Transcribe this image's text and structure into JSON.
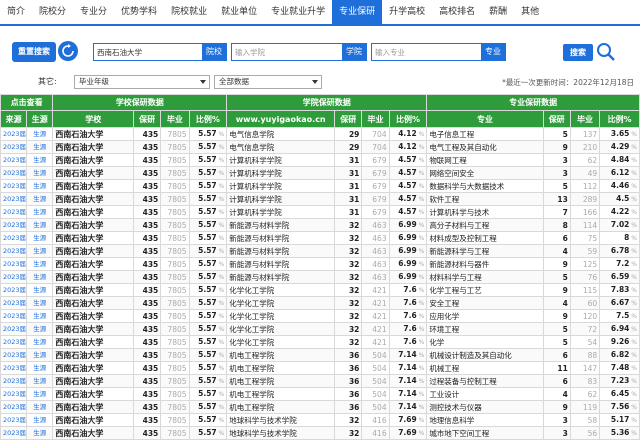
{
  "nav": [
    "简介",
    "院校分",
    "专业分",
    "优势学科",
    "院校就业",
    "就业单位",
    "专业就业升学",
    "专业保研",
    "升学高校",
    "高校排名",
    "薪酬",
    "其他"
  ],
  "nav_active": 7,
  "search": {
    "reset_label": "重置搜索",
    "school_value": "西南石油大学",
    "school_label": "院校",
    "college_placeholder": "输入学院",
    "college_label": "学院",
    "major_placeholder": "输入专业",
    "major_label": "专业",
    "search_label": "搜索"
  },
  "filters": {
    "other_label": "其它:",
    "select1": "毕业年级",
    "select2": "全部数据",
    "note": "*最近一次更新时间：2022年12月18日"
  },
  "table": {
    "group_headers": [
      "点击查看",
      "学校保研数据",
      "学院保研数据",
      "专业保研数据"
    ],
    "watermark": "www.yuyigaokao.cn",
    "columns": [
      "来源",
      "生源",
      "学校",
      "保研",
      "毕业",
      "比例%",
      "学院",
      "保研",
      "毕业",
      "比例%",
      "专业",
      "保研",
      "毕业",
      "比例%"
    ],
    "rows": [
      [
        "2023届",
        "生源",
        "西南石油大学",
        "435",
        "7805",
        "5.57",
        "电气信息学院",
        "29",
        "704",
        "4.12",
        "电子信息工程",
        "5",
        "137",
        "3.65"
      ],
      [
        "2023届",
        "生源",
        "西南石油大学",
        "435",
        "7805",
        "5.57",
        "电气信息学院",
        "29",
        "704",
        "4.12",
        "电气工程及其自动化",
        "9",
        "210",
        "4.29"
      ],
      [
        "2023届",
        "生源",
        "西南石油大学",
        "435",
        "7805",
        "5.57",
        "计算机科学学院",
        "31",
        "679",
        "4.57",
        "物联网工程",
        "3",
        "62",
        "4.84"
      ],
      [
        "2023届",
        "生源",
        "西南石油大学",
        "435",
        "7805",
        "5.57",
        "计算机科学学院",
        "31",
        "679",
        "4.57",
        "网络空间安全",
        "3",
        "49",
        "6.12"
      ],
      [
        "2023届",
        "生源",
        "西南石油大学",
        "435",
        "7805",
        "5.57",
        "计算机科学学院",
        "31",
        "679",
        "4.57",
        "数据科学与大数据技术",
        "5",
        "112",
        "4.46"
      ],
      [
        "2023届",
        "生源",
        "西南石油大学",
        "435",
        "7805",
        "5.57",
        "计算机科学学院",
        "31",
        "679",
        "4.57",
        "软件工程",
        "13",
        "289",
        "4.5"
      ],
      [
        "2023届",
        "生源",
        "西南石油大学",
        "435",
        "7805",
        "5.57",
        "计算机科学学院",
        "31",
        "679",
        "4.57",
        "计算机科学与技术",
        "7",
        "166",
        "4.22"
      ],
      [
        "2023届",
        "生源",
        "西南石油大学",
        "435",
        "7805",
        "5.57",
        "新能源与材料学院",
        "32",
        "463",
        "6.99",
        "高分子材料与工程",
        "8",
        "114",
        "7.02"
      ],
      [
        "2023届",
        "生源",
        "西南石油大学",
        "435",
        "7805",
        "5.57",
        "新能源与材料学院",
        "32",
        "463",
        "6.99",
        "材料成型及控制工程",
        "6",
        "75",
        "8"
      ],
      [
        "2023届",
        "生源",
        "西南石油大学",
        "435",
        "7805",
        "5.57",
        "新能源与材料学院",
        "32",
        "463",
        "6.99",
        "新能源科学与工程",
        "4",
        "59",
        "6.78"
      ],
      [
        "2023届",
        "生源",
        "西南石油大学",
        "435",
        "7805",
        "5.57",
        "新能源与材料学院",
        "32",
        "463",
        "6.99",
        "新能源材料与器件",
        "9",
        "125",
        "7.2"
      ],
      [
        "2023届",
        "生源",
        "西南石油大学",
        "435",
        "7805",
        "5.57",
        "新能源与材料学院",
        "32",
        "463",
        "6.99",
        "材料科学与工程",
        "5",
        "76",
        "6.59"
      ],
      [
        "2023届",
        "生源",
        "西南石油大学",
        "435",
        "7805",
        "5.57",
        "化学化工学院",
        "32",
        "421",
        "7.6",
        "化学工程与工艺",
        "9",
        "115",
        "7.83"
      ],
      [
        "2023届",
        "生源",
        "西南石油大学",
        "435",
        "7805",
        "5.57",
        "化学化工学院",
        "32",
        "421",
        "7.6",
        "安全工程",
        "4",
        "60",
        "6.67"
      ],
      [
        "2023届",
        "生源",
        "西南石油大学",
        "435",
        "7805",
        "5.57",
        "化学化工学院",
        "32",
        "421",
        "7.6",
        "应用化学",
        "9",
        "120",
        "7.5"
      ],
      [
        "2023届",
        "生源",
        "西南石油大学",
        "435",
        "7805",
        "5.57",
        "化学化工学院",
        "32",
        "421",
        "7.6",
        "环境工程",
        "5",
        "72",
        "6.94"
      ],
      [
        "2023届",
        "生源",
        "西南石油大学",
        "435",
        "7805",
        "5.57",
        "化学化工学院",
        "32",
        "421",
        "7.6",
        "化学",
        "5",
        "54",
        "9.26"
      ],
      [
        "2023届",
        "生源",
        "西南石油大学",
        "435",
        "7805",
        "5.57",
        "机电工程学院",
        "36",
        "504",
        "7.14",
        "机械设计制造及其自动化",
        "6",
        "88",
        "6.82"
      ],
      [
        "2023届",
        "生源",
        "西南石油大学",
        "435",
        "7805",
        "5.57",
        "机电工程学院",
        "36",
        "504",
        "7.14",
        "机械工程",
        "11",
        "147",
        "7.48"
      ],
      [
        "2023届",
        "生源",
        "西南石油大学",
        "435",
        "7805",
        "5.57",
        "机电工程学院",
        "36",
        "504",
        "7.14",
        "过程装备与控制工程",
        "6",
        "83",
        "7.23"
      ],
      [
        "2023届",
        "生源",
        "西南石油大学",
        "435",
        "7805",
        "5.57",
        "机电工程学院",
        "36",
        "504",
        "7.14",
        "工业设计",
        "4",
        "62",
        "6.45"
      ],
      [
        "2023届",
        "生源",
        "西南石油大学",
        "435",
        "7805",
        "5.57",
        "机电工程学院",
        "36",
        "504",
        "7.14",
        "测控技术与仪器",
        "9",
        "119",
        "7.56"
      ],
      [
        "2023届",
        "生源",
        "西南石油大学",
        "435",
        "7805",
        "5.57",
        "地球科学与技术学院",
        "32",
        "416",
        "7.69",
        "地理信息科学",
        "3",
        "58",
        "5.17"
      ],
      [
        "2023届",
        "生源",
        "西南石油大学",
        "435",
        "7805",
        "5.57",
        "地球科学与技术学院",
        "32",
        "416",
        "7.69",
        "城市地下空间工程",
        "3",
        "56",
        "5.36"
      ]
    ]
  }
}
